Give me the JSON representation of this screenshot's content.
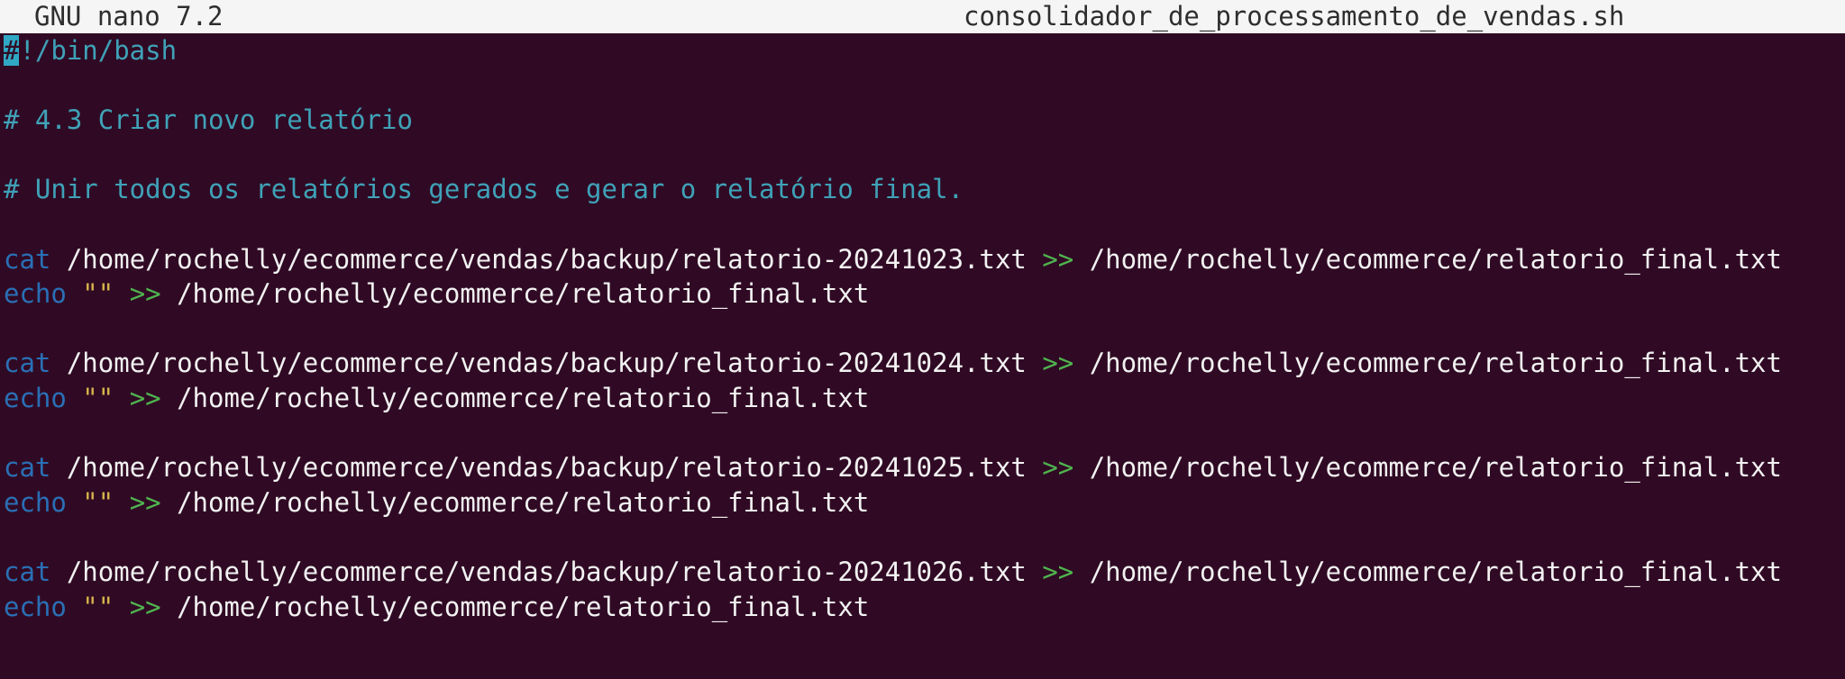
{
  "titlebar": {
    "app": "GNU nano 7.2",
    "filename": "consolidador_de_processamento_de_vendas.sh"
  },
  "editor": {
    "shebang_first_char": "#",
    "shebang_rest": "!/bin/bash",
    "comment1": "# 4.3 Criar novo relatório",
    "comment2": "# Unir todos os relatórios gerados e gerar o relatório final.",
    "blocks": [
      {
        "cat_kw": "cat",
        "cat_src": " /home/rochelly/ecommerce/vendas/backup/relatorio-20241023.txt ",
        "cat_op": ">>",
        "cat_dest": " /home/rochelly/ecommerce/relatorio_final.txt",
        "echo_kw": "echo",
        "echo_str": " \"\"",
        "echo_op": " >>",
        "echo_dest": " /home/rochelly/ecommerce/relatorio_final.txt"
      },
      {
        "cat_kw": "cat",
        "cat_src": " /home/rochelly/ecommerce/vendas/backup/relatorio-20241024.txt ",
        "cat_op": ">>",
        "cat_dest": " /home/rochelly/ecommerce/relatorio_final.txt",
        "echo_kw": "echo",
        "echo_str": " \"\"",
        "echo_op": " >>",
        "echo_dest": " /home/rochelly/ecommerce/relatorio_final.txt"
      },
      {
        "cat_kw": "cat",
        "cat_src": " /home/rochelly/ecommerce/vendas/backup/relatorio-20241025.txt ",
        "cat_op": ">>",
        "cat_dest": " /home/rochelly/ecommerce/relatorio_final.txt",
        "echo_kw": "echo",
        "echo_str": " \"\"",
        "echo_op": " >>",
        "echo_dest": " /home/rochelly/ecommerce/relatorio_final.txt"
      },
      {
        "cat_kw": "cat",
        "cat_src": " /home/rochelly/ecommerce/vendas/backup/relatorio-20241026.txt ",
        "cat_op": ">>",
        "cat_dest": " /home/rochelly/ecommerce/relatorio_final.txt",
        "echo_kw": "echo",
        "echo_str": " \"\"",
        "echo_op": " >>",
        "echo_dest": " /home/rochelly/ecommerce/relatorio_final.txt"
      }
    ]
  },
  "colors": {
    "background": "#300a24",
    "titlebar_bg": "#f5f5f5",
    "comment": "#3fa2b8",
    "keyword": "#2a6fb5",
    "string": "#d4b24a",
    "operator": "#4fb54f",
    "cursor": "#2fa8c4"
  }
}
